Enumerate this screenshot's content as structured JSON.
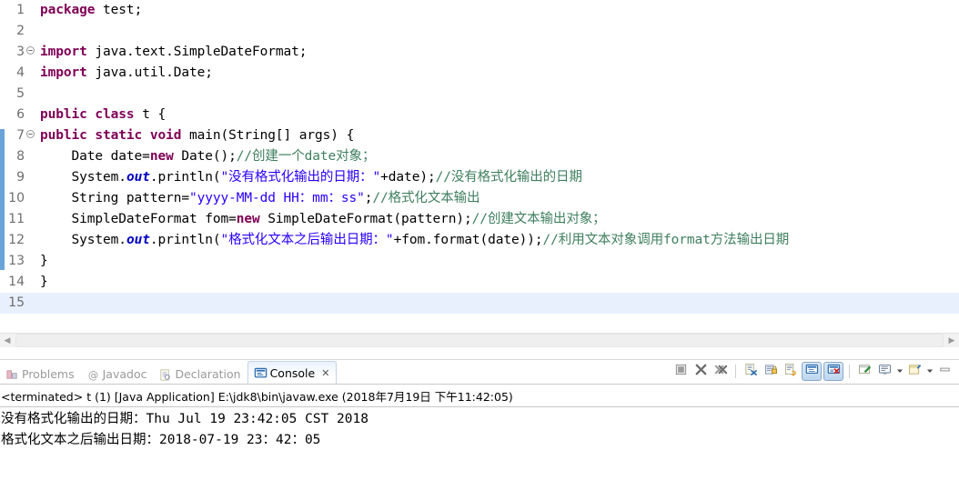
{
  "editor": {
    "current_line": 15,
    "change_bar_color": "#6aa3d8",
    "lines": [
      {
        "n": "1",
        "fold": "",
        "tokens": [
          {
            "t": "package ",
            "c": "kw"
          },
          {
            "t": "test;",
            "c": "pl"
          }
        ]
      },
      {
        "n": "2",
        "fold": "",
        "tokens": []
      },
      {
        "n": "3",
        "fold": "-",
        "tokens": [
          {
            "t": "import ",
            "c": "kw"
          },
          {
            "t": "java.text.SimpleDateFormat;",
            "c": "pl"
          }
        ]
      },
      {
        "n": "4",
        "fold": "",
        "tokens": [
          {
            "t": "import ",
            "c": "kw"
          },
          {
            "t": "java.util.Date;",
            "c": "pl"
          }
        ]
      },
      {
        "n": "5",
        "fold": "",
        "tokens": []
      },
      {
        "n": "6",
        "fold": "",
        "tokens": [
          {
            "t": "public class ",
            "c": "kw"
          },
          {
            "t": "t {",
            "c": "pl"
          }
        ]
      },
      {
        "n": "7",
        "fold": "-",
        "tokens": [
          {
            "t": "public static void ",
            "c": "kw"
          },
          {
            "t": "main(String[] args) {",
            "c": "pl"
          }
        ]
      },
      {
        "n": "8",
        "fold": "",
        "tokens": [
          {
            "t": "    Date date=",
            "c": "pl"
          },
          {
            "t": "new",
            "c": "kw"
          },
          {
            "t": " Date();",
            "c": "pl"
          },
          {
            "t": "//创建一个date对象；",
            "c": "cmt"
          }
        ]
      },
      {
        "n": "9",
        "fold": "",
        "tokens": [
          {
            "t": "    System.",
            "c": "pl"
          },
          {
            "t": "out",
            "c": "fld"
          },
          {
            "t": ".println(",
            "c": "pl"
          },
          {
            "t": "\"没有格式化输出的日期：\"",
            "c": "str"
          },
          {
            "t": "+date);",
            "c": "pl"
          },
          {
            "t": "//没有格式化输出的日期",
            "c": "cmt"
          }
        ]
      },
      {
        "n": "10",
        "fold": "",
        "tokens": [
          {
            "t": "    String pattern=",
            "c": "pl"
          },
          {
            "t": "\"yyyy-MM-dd HH：mm：ss\"",
            "c": "str"
          },
          {
            "t": ";",
            "c": "pl"
          },
          {
            "t": "//格式化文本输出",
            "c": "cmt"
          }
        ]
      },
      {
        "n": "11",
        "fold": "",
        "tokens": [
          {
            "t": "    SimpleDateFormat fom=",
            "c": "pl"
          },
          {
            "t": "new",
            "c": "kw"
          },
          {
            "t": " SimpleDateFormat(pattern);",
            "c": "pl"
          },
          {
            "t": "//创建文本输出对象；",
            "c": "cmt"
          }
        ]
      },
      {
        "n": "12",
        "fold": "",
        "tokens": [
          {
            "t": "    System.",
            "c": "pl"
          },
          {
            "t": "out",
            "c": "fld"
          },
          {
            "t": ".println(",
            "c": "pl"
          },
          {
            "t": "\"格式化文本之后输出日期：\"",
            "c": "str"
          },
          {
            "t": "+fom.format(date));",
            "c": "pl"
          },
          {
            "t": "//利用文本对象调用format方法输出日期",
            "c": "cmt"
          }
        ]
      },
      {
        "n": "13",
        "fold": "",
        "tokens": [
          {
            "t": "}",
            "c": "pl"
          }
        ]
      },
      {
        "n": "14",
        "fold": "",
        "tokens": [
          {
            "t": "}",
            "c": "pl"
          }
        ]
      },
      {
        "n": "15",
        "fold": "",
        "tokens": []
      }
    ]
  },
  "panel": {
    "tabs": [
      {
        "label": "Problems",
        "icon": "problems-icon",
        "active": false
      },
      {
        "label": "Javadoc",
        "icon": "javadoc-icon",
        "active": false
      },
      {
        "label": "Declaration",
        "icon": "declaration-icon",
        "active": false
      },
      {
        "label": "Console",
        "icon": "console-icon",
        "active": true,
        "close": "✕"
      }
    ],
    "toolbar": [
      {
        "name": "terminate-all-button",
        "icon": "stop-square-icon",
        "pressed": false
      },
      {
        "name": "remove-launch-button",
        "icon": "remove-x-icon",
        "pressed": false
      },
      {
        "name": "remove-all-terminated-button",
        "icon": "remove-all-xx-icon",
        "pressed": false
      },
      {
        "name": "separator-1",
        "icon": "separator",
        "pressed": false
      },
      {
        "name": "clear-console-button",
        "icon": "clear-console-icon",
        "pressed": false
      },
      {
        "name": "scroll-lock-button",
        "icon": "scroll-lock-icon",
        "pressed": false
      },
      {
        "name": "word-wrap-button",
        "icon": "word-wrap-icon",
        "pressed": false
      },
      {
        "name": "show-console-on-output-button",
        "icon": "console-out-icon",
        "pressed": true
      },
      {
        "name": "show-console-on-error-button",
        "icon": "console-err-icon",
        "pressed": true
      },
      {
        "name": "separator-2",
        "icon": "separator",
        "pressed": false
      },
      {
        "name": "pin-console-button",
        "icon": "pin-console-icon",
        "pressed": false
      },
      {
        "name": "display-selected-console-button",
        "icon": "display-console-icon",
        "pressed": false
      },
      {
        "name": "display-console-dropdown",
        "icon": "chevron-down-icon",
        "pressed": false
      },
      {
        "name": "open-console-button",
        "icon": "open-console-icon",
        "pressed": false
      },
      {
        "name": "open-console-dropdown",
        "icon": "chevron-down-icon",
        "pressed": false
      },
      {
        "name": "minimize-button",
        "icon": "minimize-icon",
        "pressed": false
      }
    ],
    "console": {
      "header": "<terminated> t (1) [Java Application] E:\\jdk8\\bin\\javaw.exe (2018年7月19日 下午11:42:05)",
      "output": [
        "没有格式化输出的日期：Thu Jul 19 23:42:05 CST 2018",
        "格式化文本之后输出日期：2018-07-19 23：42：05"
      ]
    }
  }
}
